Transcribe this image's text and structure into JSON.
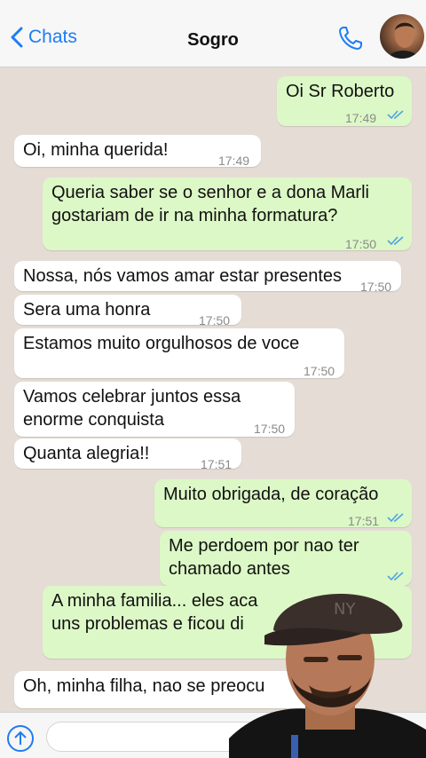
{
  "header": {
    "back_label": "Chats",
    "title": "Sogro"
  },
  "messages": [
    {
      "text": "Oi Sr Roberto",
      "time": "17:49"
    },
    {
      "text": "Oi, minha querida!",
      "time": "17:49"
    },
    {
      "text": "Queria saber se o senhor e a dona Marli",
      "text2": "gostariam de ir na minha formatura?",
      "time": "17:50"
    },
    {
      "text": "Nossa, nós vamos amar estar presentes",
      "time": "17:50"
    },
    {
      "text": "Sera uma honra",
      "time": "17:50"
    },
    {
      "text": "Estamos muito orgulhosos de voce",
      "time": "17:50"
    },
    {
      "text": "Vamos celebrar juntos essa",
      "text2": "enorme conquista",
      "time": "17:50"
    },
    {
      "text": "Quanta alegria!!",
      "time": "17:51"
    },
    {
      "text": "Muito obrigada, de coração",
      "time": "17:51"
    },
    {
      "text": "Me perdoem por nao ter",
      "text2": "chamado antes"
    },
    {
      "text": "A minha familia... eles aca",
      "text2": "uns problemas e ficou di"
    },
    {
      "text": "Oh, minha filha, nao se preocu"
    }
  ],
  "colors": {
    "incoming": "#ffffff",
    "outgoing": "#dcf8c6",
    "accent": "#1e7cf2",
    "read_ticks": "#4fa3e0"
  }
}
